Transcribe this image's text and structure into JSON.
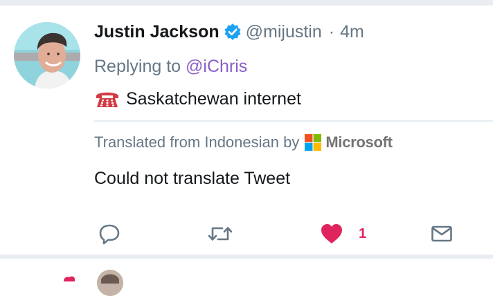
{
  "tweet": {
    "author_name": "Justin Jackson",
    "handle": "@mijustin",
    "separator": "·",
    "timestamp": "4m",
    "replying_prefix": "Replying to",
    "replying_to": "@iChris",
    "body_text": "Saskatchewan internet",
    "body_emoji_icon": "telephone-icon",
    "translated_label": "Translated from Indonesian by",
    "translator_name": "Microsoft",
    "translation_text": "Could not translate Tweet"
  },
  "actions": {
    "reply_icon": "reply-icon",
    "retweet_icon": "retweet-icon",
    "like_icon": "heart-icon",
    "like_count": "1",
    "dm_icon": "envelope-icon"
  },
  "colors": {
    "text_primary": "#14171a",
    "text_secondary": "#657786",
    "mention": "#8b5fc7",
    "like": "#e0245e",
    "verified": "#1da1f2",
    "icon_gray": "#657786",
    "separator": "#e9edf2"
  }
}
